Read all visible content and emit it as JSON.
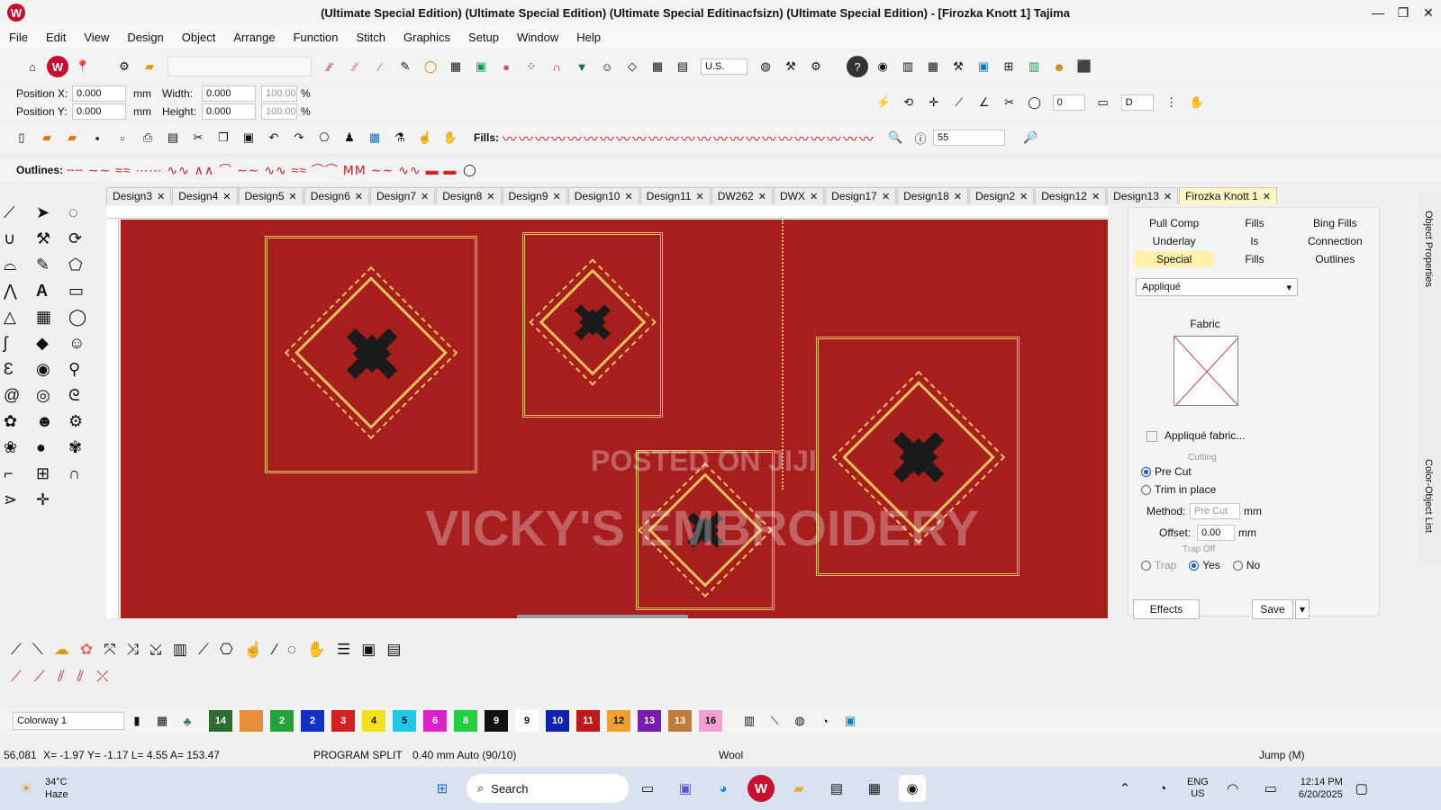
{
  "app": {
    "title": "(Ultimate Special Edition) (Ultimate Special Edition) (Ultimate Special Editinacfsizn) (Ultimate Special Edition) - [Firozka Knott 1]   Tajima",
    "logo": "W"
  },
  "menu": [
    "File",
    "Edit",
    "View",
    "Design",
    "Object",
    "Arrange",
    "Function",
    "Stitch",
    "Graphics",
    "Setup",
    "Window",
    "Help"
  ],
  "position": {
    "x_label": "Position X:",
    "y_label": "Position Y:",
    "x_value": "0.000",
    "y_value": "0.000",
    "width_label": "Width:",
    "height_label": "Height:",
    "width_value": "0.000",
    "height_value": "0.000",
    "pct_w": "100.00",
    "pct_h": "100.00",
    "unit_mm": "mm",
    "unit_pct": "%"
  },
  "toolbar": {
    "unit": "U.S.",
    "fills_label": "Fills:",
    "outlines_label": "Outlines:",
    "zoom": "55",
    "field_zero": "0",
    "field_d": "D"
  },
  "tabs": [
    "Design3",
    "Design4",
    "Design5",
    "Design6",
    "Design7",
    "Design8",
    "Design9",
    "Design10",
    "Design11",
    "DW262",
    "DWX",
    "Design17",
    "Design18",
    "Design2",
    "Design12",
    "Design13",
    "Firozka Knott 1"
  ],
  "watermarks": {
    "posted": "POSTED ON JIJI",
    "vicky": "VICKY'S EMBROIDERY"
  },
  "panel": {
    "tabs": [
      "Pull Comp",
      "Fills",
      "Bing Fills",
      "Underlay",
      "ls",
      "Connection",
      "Special",
      "Fills",
      "Outlines"
    ],
    "dropdown": "Appliqué",
    "fabric_label": "Fabric",
    "checkbox": "Appliqué fabric...",
    "small_text": "Cutting",
    "radio_pre_cut": "Pre Cut",
    "radio_trim": "Trim in place",
    "method_label": "Method:",
    "method_value": "Pre Cut",
    "offset_label": "Offset:",
    "offset_value": "0.00",
    "unit": "mm",
    "small_text2": "Trap Off",
    "trap": "Trap",
    "yes": "Yes",
    "no": "No",
    "effects": "Effects",
    "save": "Save"
  },
  "sidepanel": {
    "a": "Object Properties",
    "b": "Color-Object List"
  },
  "colorway": {
    "label": "Colorway 1",
    "swatches": [
      {
        "n": "14",
        "c": "#2e6b2e"
      },
      {
        "n": "",
        "c": "#e88d3a"
      },
      {
        "n": "2",
        "c": "#22a33a"
      },
      {
        "n": "2",
        "c": "#1030c8"
      },
      {
        "n": "3",
        "c": "#d42020"
      },
      {
        "n": "4",
        "c": "#f2e21c"
      },
      {
        "n": "5",
        "c": "#1ec8e8"
      },
      {
        "n": "6",
        "c": "#e020c8"
      },
      {
        "n": "8",
        "c": "#20d040"
      },
      {
        "n": "9",
        "c": "#111111"
      },
      {
        "n": "9",
        "c": "#ffffff"
      },
      {
        "n": "10",
        "c": "#1020b0"
      },
      {
        "n": "11",
        "c": "#c01818"
      },
      {
        "n": "12",
        "c": "#f0a030"
      },
      {
        "n": "13",
        "c": "#7a1ab0"
      },
      {
        "n": "13",
        "c": "#c07a3a"
      },
      {
        "n": "16",
        "c": "#f2a0d0"
      }
    ]
  },
  "status": {
    "stitch": "56,081",
    "coords": "X= -1.97  Y= -1.17   L= 4.55  A= 153.47",
    "mode": "PROGRAM SPLIT",
    "density": "0.40 mm Auto (90/10)",
    "thread": "Wool",
    "jump": "Jump (M)"
  },
  "taskbar": {
    "temp": "34°C",
    "weather": "Haze",
    "search": "Search",
    "lang1": "ENG",
    "lang2": "US",
    "time": "12:14 PM",
    "date": "6/20/2025"
  }
}
